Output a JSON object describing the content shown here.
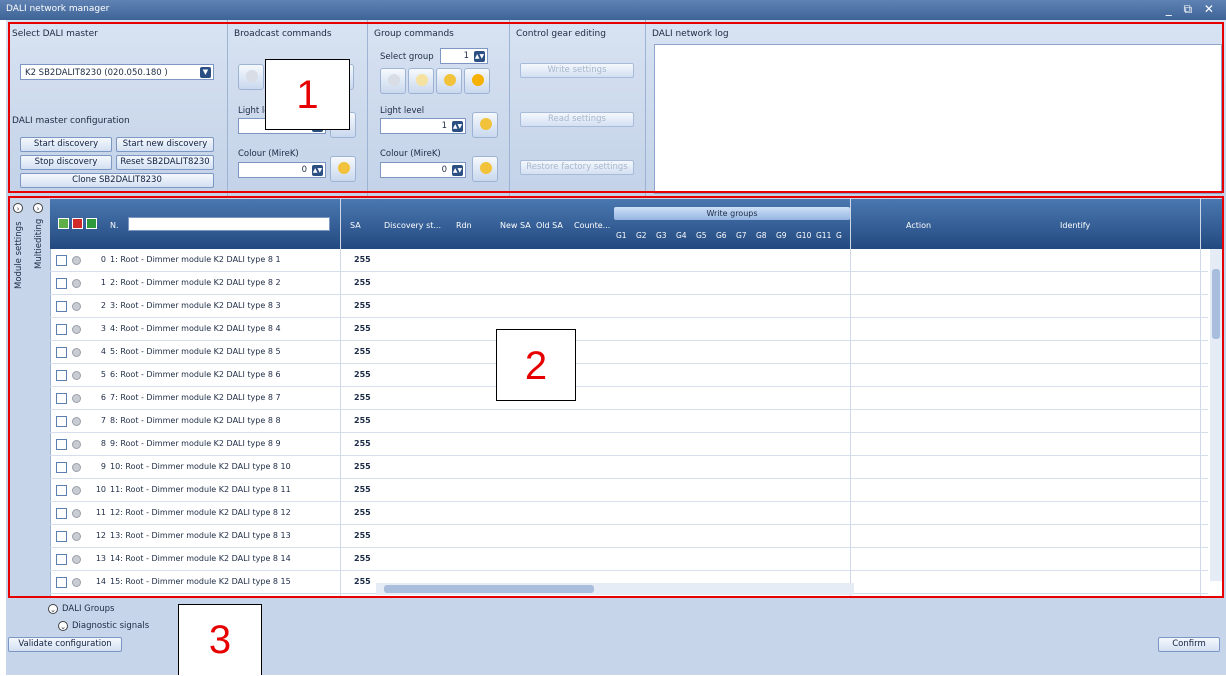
{
  "window": {
    "title": "DALI network manager",
    "controls": "_ ⧉ ✕"
  },
  "select_master": {
    "legend": "Select DALI master",
    "value": "K2 SB2DALIT8230 (020.050.180 )"
  },
  "master_config": {
    "legend": "DALI master configuration",
    "start_discovery": "Start discovery",
    "start_new_discovery": "Start new discovery",
    "stop_discovery": "Stop discovery",
    "reset": "Reset SB2DALIT8230",
    "clone": "Clone SB2DALIT8230"
  },
  "broadcast": {
    "legend": "Broadcast commands",
    "light_level_label": "Light le",
    "colour_label": "Colour (MireK)",
    "colour_value": "0"
  },
  "group": {
    "legend": "Group commands",
    "select_group_label": "Select group",
    "select_group_value": "1",
    "light_level_label": "Light level",
    "light_level_value": "1",
    "colour_label": "Colour (MireK)",
    "colour_value": "0"
  },
  "control_gear": {
    "legend": "Control gear editing",
    "write": "Write settings",
    "read": "Read settings",
    "restore": "Restore factory settings"
  },
  "log": {
    "legend": "DALI network log"
  },
  "callouts": {
    "one": "1",
    "two": "2",
    "three": "3"
  },
  "sidebar": {
    "module_settings": "Module settings",
    "multiediting": "Multiediting"
  },
  "table": {
    "headers": {
      "n": "N.",
      "sa": "SA",
      "discovery": "Discovery st...",
      "rdn": "Rdn",
      "new_sa": "New SA",
      "old_sa": "Old SA",
      "counter": "Counte...",
      "write_groups": "Write groups",
      "action": "Action",
      "identify": "Identify"
    },
    "groups": [
      "G1",
      "G2",
      "G3",
      "G4",
      "G5",
      "G6",
      "G7",
      "G8",
      "G9",
      "G10",
      "G11",
      "G"
    ],
    "rows": [
      {
        "n": "0",
        "name": "1: Root - Dimmer module K2  DALI type 8 1",
        "sa": "255"
      },
      {
        "n": "1",
        "name": "2: Root - Dimmer module K2  DALI type 8 2",
        "sa": "255"
      },
      {
        "n": "2",
        "name": "3: Root - Dimmer module K2  DALI type 8 3",
        "sa": "255"
      },
      {
        "n": "3",
        "name": "4: Root - Dimmer module K2  DALI type 8 4",
        "sa": "255"
      },
      {
        "n": "4",
        "name": "5: Root - Dimmer module K2  DALI type 8 5",
        "sa": "255"
      },
      {
        "n": "5",
        "name": "6: Root - Dimmer module K2  DALI type 8 6",
        "sa": "255"
      },
      {
        "n": "6",
        "name": "7: Root - Dimmer module K2  DALI type 8 7",
        "sa": "255"
      },
      {
        "n": "7",
        "name": "8: Root - Dimmer module K2  DALI type 8 8",
        "sa": "255"
      },
      {
        "n": "8",
        "name": "9: Root - Dimmer module K2  DALI type 8 9",
        "sa": "255"
      },
      {
        "n": "9",
        "name": "10: Root - Dimmer module K2  DALI type 8 10",
        "sa": "255"
      },
      {
        "n": "10",
        "name": "11: Root - Dimmer module K2  DALI type 8 11",
        "sa": "255"
      },
      {
        "n": "11",
        "name": "12: Root - Dimmer module K2  DALI type 8 12",
        "sa": "255"
      },
      {
        "n": "12",
        "name": "13: Root - Dimmer module K2  DALI type 8 13",
        "sa": "255"
      },
      {
        "n": "13",
        "name": "14: Root - Dimmer module K2  DALI type 8 14",
        "sa": "255"
      },
      {
        "n": "14",
        "name": "15: Root - Dimmer module K2  DALI type 8 15",
        "sa": "255"
      }
    ]
  },
  "footer": {
    "dali_groups": "DALI Groups",
    "diagnostic": "Diagnostic signals",
    "validate": "Validate configuration",
    "confirm": "Confirm"
  },
  "colors": {
    "accent": "#e60000",
    "header": "#2b4f82",
    "panel": "#c7d5eb"
  }
}
